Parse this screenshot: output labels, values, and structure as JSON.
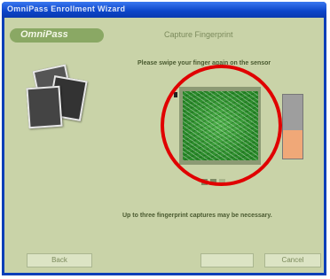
{
  "window": {
    "title": "OmniPass Enrollment Wizard"
  },
  "header": {
    "logo_text": "OmniPass",
    "title": "Capture Fingerprint"
  },
  "main": {
    "instruction": "Please swipe your finger again on the sensor",
    "note": "Up to three fingerprint captures may be necessary.",
    "capture_progress": {
      "completed": 2,
      "total": 3
    },
    "quality_level": 0.45
  },
  "footer": {
    "back_label": "Back",
    "next_label": "",
    "cancel_label": "Cancel"
  },
  "colors": {
    "background": "#c9d3a8",
    "fingerprint": "#3a9a3a",
    "annotation_circle": "#e00000",
    "gauge_fill": "#f0a878"
  },
  "icons": [
    "photos-icon",
    "fingerprint-image",
    "capture-dot"
  ]
}
